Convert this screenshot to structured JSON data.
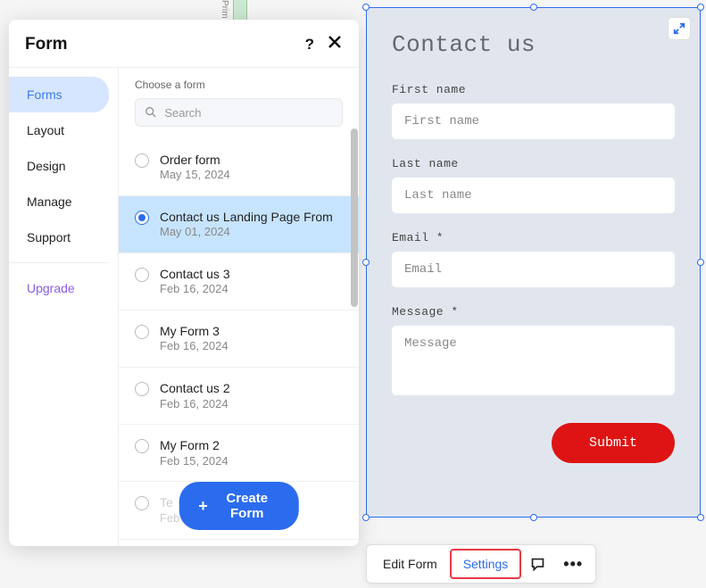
{
  "bgLabel": "Prim",
  "panel": {
    "title": "Form",
    "sidebar": {
      "items": [
        {
          "label": "Forms",
          "selected": true
        },
        {
          "label": "Layout",
          "selected": false
        },
        {
          "label": "Design",
          "selected": false
        },
        {
          "label": "Manage",
          "selected": false
        },
        {
          "label": "Support",
          "selected": false
        }
      ],
      "upgrade": "Upgrade"
    },
    "content": {
      "chooseLabel": "Choose a form",
      "searchPlaceholder": "Search",
      "createButton": "Create Form",
      "forms": [
        {
          "name": "Order form",
          "date": "May 15, 2024",
          "selected": false
        },
        {
          "name": "Contact us Landing Page From",
          "date": "May 01, 2024",
          "selected": true
        },
        {
          "name": "Contact us 3",
          "date": "Feb 16, 2024",
          "selected": false
        },
        {
          "name": "My Form 3",
          "date": "Feb 16, 2024",
          "selected": false
        },
        {
          "name": "Contact us 2",
          "date": "Feb 16, 2024",
          "selected": false
        },
        {
          "name": "My Form 2",
          "date": "Feb 15, 2024",
          "selected": false
        },
        {
          "name": "Te",
          "date": "Feb 14, 2024",
          "selected": false,
          "faded": true
        }
      ]
    }
  },
  "preview": {
    "title": "Contact us",
    "fields": {
      "firstName": {
        "label": "First name",
        "placeholder": "First name"
      },
      "lastName": {
        "label": "Last name",
        "placeholder": "Last name"
      },
      "email": {
        "label": "Email *",
        "placeholder": "Email"
      },
      "message": {
        "label": "Message *",
        "placeholder": "Message"
      }
    },
    "submit": "Submit"
  },
  "toolbar": {
    "editForm": "Edit Form",
    "settings": "Settings"
  }
}
